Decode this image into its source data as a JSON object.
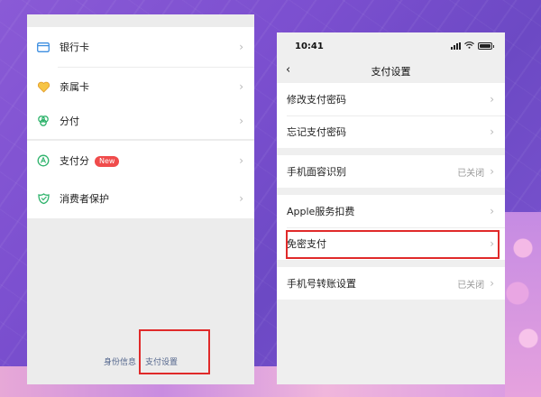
{
  "left_menu": {
    "group1": [
      {
        "label": "银行卡",
        "icon": "card-icon"
      },
      {
        "label": "亲属卡",
        "icon": "family-card-icon"
      }
    ],
    "group2": [
      {
        "label": "分付",
        "icon": "installment-icon"
      }
    ],
    "group3": [
      {
        "label": "支付分",
        "icon": "pay-score-icon",
        "badge": "New"
      }
    ],
    "group4": [
      {
        "label": "消费者保护",
        "icon": "consumer-protection-icon"
      }
    ],
    "footer": {
      "identity": "身份信息",
      "pay_settings": "支付设置"
    }
  },
  "phone": {
    "time": "10:41",
    "title": "支付设置",
    "groups": [
      [
        {
          "label": "修改支付密码"
        },
        {
          "label": "忘记支付密码"
        }
      ],
      [
        {
          "label": "手机面容识别",
          "value": "已关闭"
        }
      ],
      [
        {
          "label": "Apple服务扣费"
        },
        {
          "label": "免密支付"
        }
      ],
      [
        {
          "label": "手机号转账设置",
          "value": "已关闭"
        }
      ]
    ]
  },
  "colors": {
    "highlight": "#e02a2a",
    "badge": "#f04b4b",
    "link": "#52658c"
  }
}
